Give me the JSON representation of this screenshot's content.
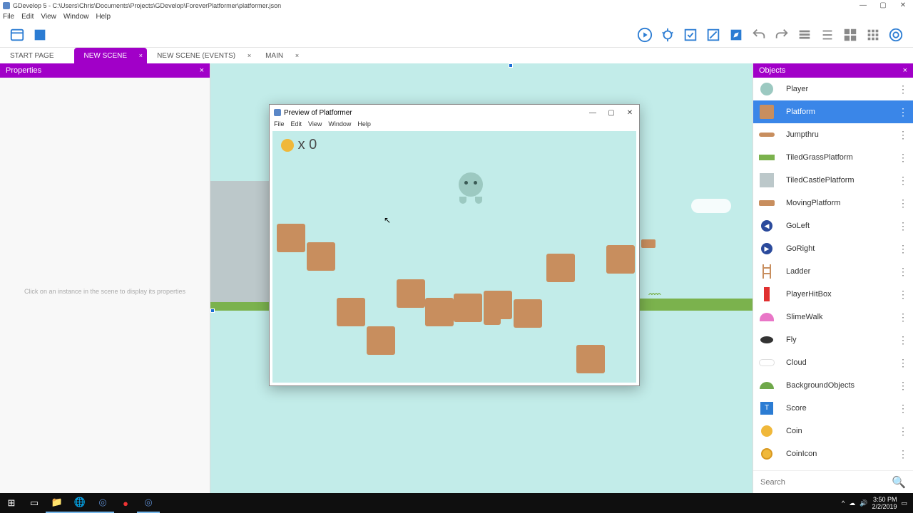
{
  "window": {
    "title": "GDevelop 5 - C:\\Users\\Chris\\Documents\\Projects\\GDevelop\\ForeverPlatformer\\platformer.json",
    "min": "—",
    "max": "▢",
    "close": "✕"
  },
  "mainmenu": [
    "File",
    "Edit",
    "View",
    "Window",
    "Help"
  ],
  "tabs": [
    {
      "label": "START PAGE",
      "closable": false,
      "active": false
    },
    {
      "label": "NEW SCENE",
      "closable": true,
      "active": true
    },
    {
      "label": "NEW SCENE (EVENTS)",
      "closable": true,
      "active": false
    },
    {
      "label": "MAIN",
      "closable": true,
      "active": false
    }
  ],
  "panels": {
    "properties_title": "Properties",
    "properties_placeholder": "Click on an instance in the scene to display its properties",
    "objects_title": "Objects"
  },
  "objects": [
    {
      "name": "Player",
      "icon": "player",
      "sel": false
    },
    {
      "name": "Platform",
      "icon": "platform",
      "sel": true
    },
    {
      "name": "Jumpthru",
      "icon": "jumpthru",
      "sel": false
    },
    {
      "name": "TiledGrassPlatform",
      "icon": "grass",
      "sel": false
    },
    {
      "name": "TiledCastlePlatform",
      "icon": "castle",
      "sel": false
    },
    {
      "name": "MovingPlatform",
      "icon": "moving",
      "sel": false
    },
    {
      "name": "GoLeft",
      "icon": "goleft",
      "sel": false
    },
    {
      "name": "GoRight",
      "icon": "goright",
      "sel": false
    },
    {
      "name": "Ladder",
      "icon": "ladder",
      "sel": false
    },
    {
      "name": "PlayerHitBox",
      "icon": "hitbox",
      "sel": false
    },
    {
      "name": "SlimeWalk",
      "icon": "slime",
      "sel": false
    },
    {
      "name": "Fly",
      "icon": "fly",
      "sel": false
    },
    {
      "name": "Cloud",
      "icon": "cloud",
      "sel": false
    },
    {
      "name": "BackgroundObjects",
      "icon": "bg",
      "sel": false
    },
    {
      "name": "Score",
      "icon": "score",
      "sel": false
    },
    {
      "name": "Coin",
      "icon": "coin",
      "sel": false
    },
    {
      "name": "CoinIcon",
      "icon": "coinicon",
      "sel": false
    }
  ],
  "search_placeholder": "Search",
  "preview": {
    "title": "Preview of Platformer",
    "menu": [
      "File",
      "Edit",
      "View",
      "Window",
      "Help"
    ],
    "score_text": "x 0"
  },
  "taskbar": {
    "time": "3:50 PM",
    "date": "2/2/2019"
  }
}
